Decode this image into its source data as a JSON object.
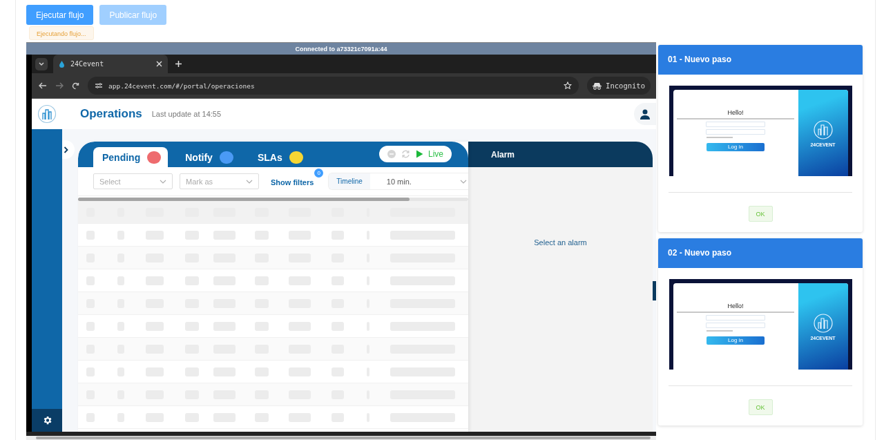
{
  "toolbar": {
    "buttons": [
      {
        "label": "Ejecutar flujo",
        "disabled": false
      },
      {
        "label": "Publicar flujo",
        "disabled": true
      }
    ],
    "status": "Ejecutando flujo..."
  },
  "remote": {
    "connection": "Connected to a73321c7091a:44",
    "browser": {
      "tabs": [
        {
          "title": "24Cevent",
          "selected": true
        }
      ],
      "url": "app.24cevent.com/#/portal/operaciones",
      "profile": "Incognito"
    },
    "app": {
      "title": "Operations",
      "last_update": "Last update at 14:55",
      "tabs": [
        {
          "label": "Pending",
          "color": "#ee6b6e",
          "selected": true
        },
        {
          "label": "Notify",
          "color": "#4a9af5",
          "selected": false
        },
        {
          "label": "SLAs",
          "color": "#f5d634",
          "selected": false
        }
      ],
      "live": "Live",
      "filters": {
        "select": {
          "placeholder": "Select"
        },
        "mark_as": {
          "placeholder": "Mark as"
        },
        "show_filters": "Show filters",
        "filter_count": "0",
        "timeline_label": "Timeline",
        "timeline_value": "10 min."
      },
      "detail": {
        "title": "Alarm",
        "empty": "Select an alarm"
      }
    }
  },
  "steps": [
    {
      "title": "01 - Nuevo paso",
      "preview": {
        "heading": "Hello!",
        "brand": "24CEVENT",
        "button": "Log in"
      },
      "ok": "OK"
    },
    {
      "title": "02 - Nuevo paso",
      "preview": {
        "heading": "Hello!",
        "brand": "24CEVENT",
        "button": "Log in"
      },
      "ok": "OK"
    }
  ]
}
